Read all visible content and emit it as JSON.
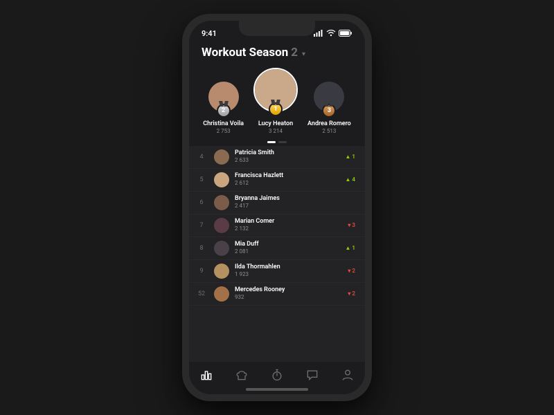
{
  "status": {
    "time": "9:41"
  },
  "header": {
    "title": "Workout Season",
    "number": "2"
  },
  "colors": {
    "up": "#8fce00",
    "down": "#e84a3a",
    "medal_gold": "#ffd75e",
    "medal_silver": "#d8d8d8",
    "medal_bronze": "#d89a5e"
  },
  "avatar_colors": [
    "#b88a6e",
    "#c9a98a",
    "#3a3a42",
    "#8a6b52",
    "#caa67f",
    "#7a5c48",
    "#5a3c46",
    "#4a4048",
    "#b59060",
    "#a47048"
  ],
  "podium": [
    {
      "rank": 2,
      "name": "Christina Voila",
      "score": "2 753",
      "medal": "silver"
    },
    {
      "rank": 1,
      "name": "Lucy Heaton",
      "score": "3 214",
      "medal": "gold"
    },
    {
      "rank": 3,
      "name": "Andrea Romero",
      "score": "2 513",
      "medal": "bronze"
    }
  ],
  "list": [
    {
      "rank": "4",
      "name": "Patricia Smith",
      "score": "2 633",
      "delta": "▲ 1",
      "dir": "up"
    },
    {
      "rank": "5",
      "name": "Francisca Hazlett",
      "score": "2 612",
      "delta": "▲ 4",
      "dir": "up"
    },
    {
      "rank": "6",
      "name": "Bryanna Jaimes",
      "score": "2 417",
      "delta": "",
      "dir": ""
    },
    {
      "rank": "7",
      "name": "Marian Comer",
      "score": "2 132",
      "delta": "▾ 3",
      "dir": "down"
    },
    {
      "rank": "8",
      "name": "Mia Duff",
      "score": "2 081",
      "delta": "▲ 1",
      "dir": "up"
    },
    {
      "rank": "9",
      "name": "Ilda Thormahlen",
      "score": "1 923",
      "delta": "▾ 2",
      "dir": "down"
    },
    {
      "rank": "52",
      "name": "Mercedes Rooney",
      "score": "932",
      "delta": "▾ 2",
      "dir": "down"
    }
  ],
  "tabs": [
    {
      "name": "leaderboard-tab",
      "icon": "bars-icon",
      "active": true
    },
    {
      "name": "workouts-tab",
      "icon": "chef-icon",
      "active": false
    },
    {
      "name": "timer-tab",
      "icon": "stopwatch-icon",
      "active": false
    },
    {
      "name": "chat-tab",
      "icon": "chat-icon",
      "active": false
    },
    {
      "name": "profile-tab",
      "icon": "person-icon",
      "active": false
    }
  ]
}
